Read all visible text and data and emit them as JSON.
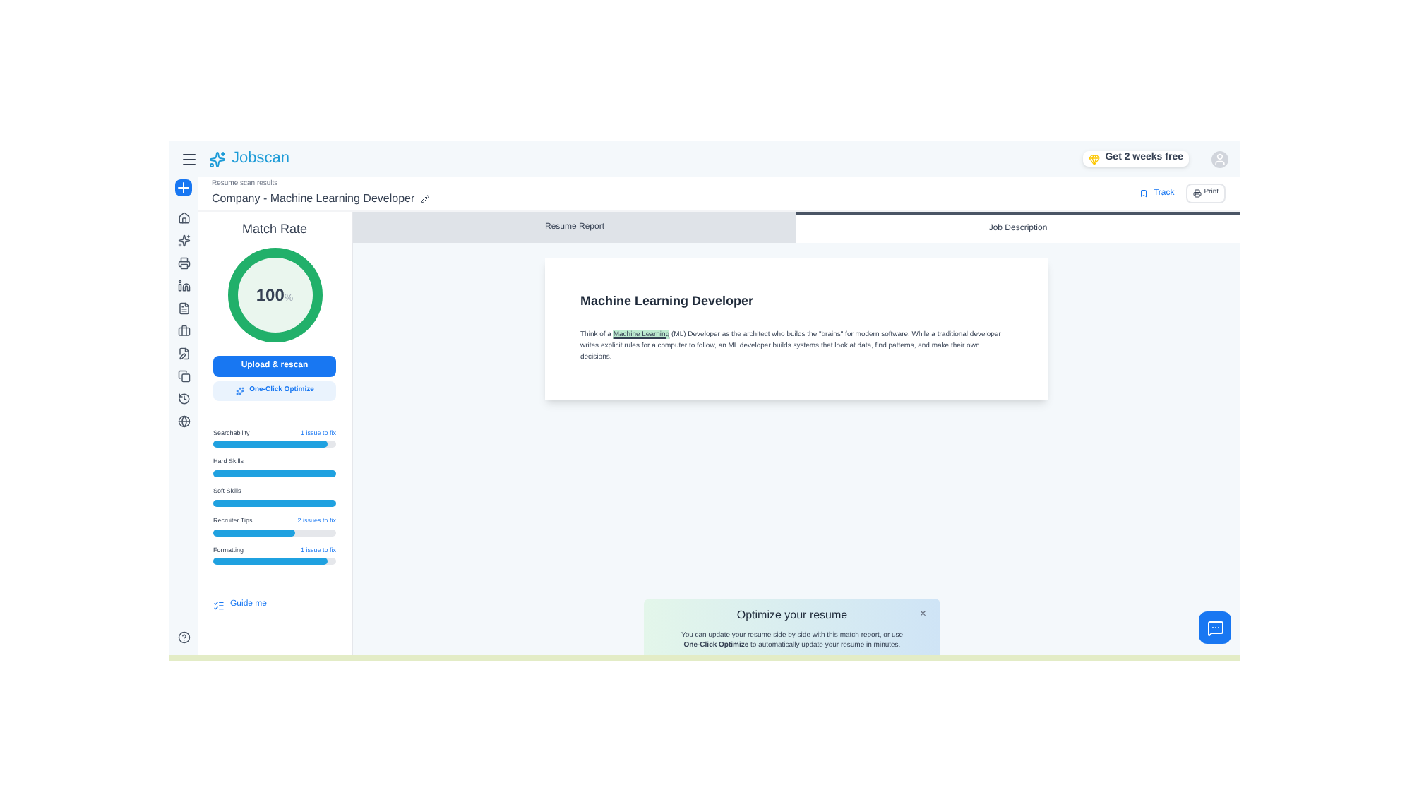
{
  "topbar": {
    "logo": "Jobscan",
    "promo": "Get 2 weeks free"
  },
  "header": {
    "caption": "Resume scan results",
    "title": "Company - Machine Learning Developer",
    "track": "Track",
    "print": "Print"
  },
  "score": {
    "title": "Match Rate",
    "value": "100",
    "unit": "%",
    "level": 1,
    "upload": "Upload & rescan",
    "optimize": "One-Click Optimize"
  },
  "categories": [
    {
      "name": "Searchability",
      "issues": "1 issue to fix",
      "level": 0.93
    },
    {
      "name": "Hard Skills",
      "level": 1
    },
    {
      "name": "Soft Skills",
      "level": 1
    },
    {
      "name": "Recruiter Tips",
      "issues": "2 issues to fix",
      "level": 0.67
    },
    {
      "name": "Formatting",
      "issues": "1 issue to fix",
      "level": 0.93
    }
  ],
  "guide": "Guide me",
  "tabs": [
    {
      "label": "Resume Report",
      "selected": false
    },
    {
      "label": "Job Description",
      "selected": true
    }
  ],
  "job": {
    "title": "Machine Learning Developer",
    "before": "Think of a ",
    "highlight": "Machine Learning",
    "after": " (ML) Developer as the architect who builds the \"brains\" for modern software. While a traditional developer writes explicit rules for a computer to follow, an ML developer builds systems that look at data, find patterns, and make their own decisions."
  },
  "toast": {
    "title": "Optimize your resume",
    "close": "×",
    "text": "You can update your resume side by side with this match report, or use **One-Click Optimize** to automatically update your resume in minutes."
  }
}
